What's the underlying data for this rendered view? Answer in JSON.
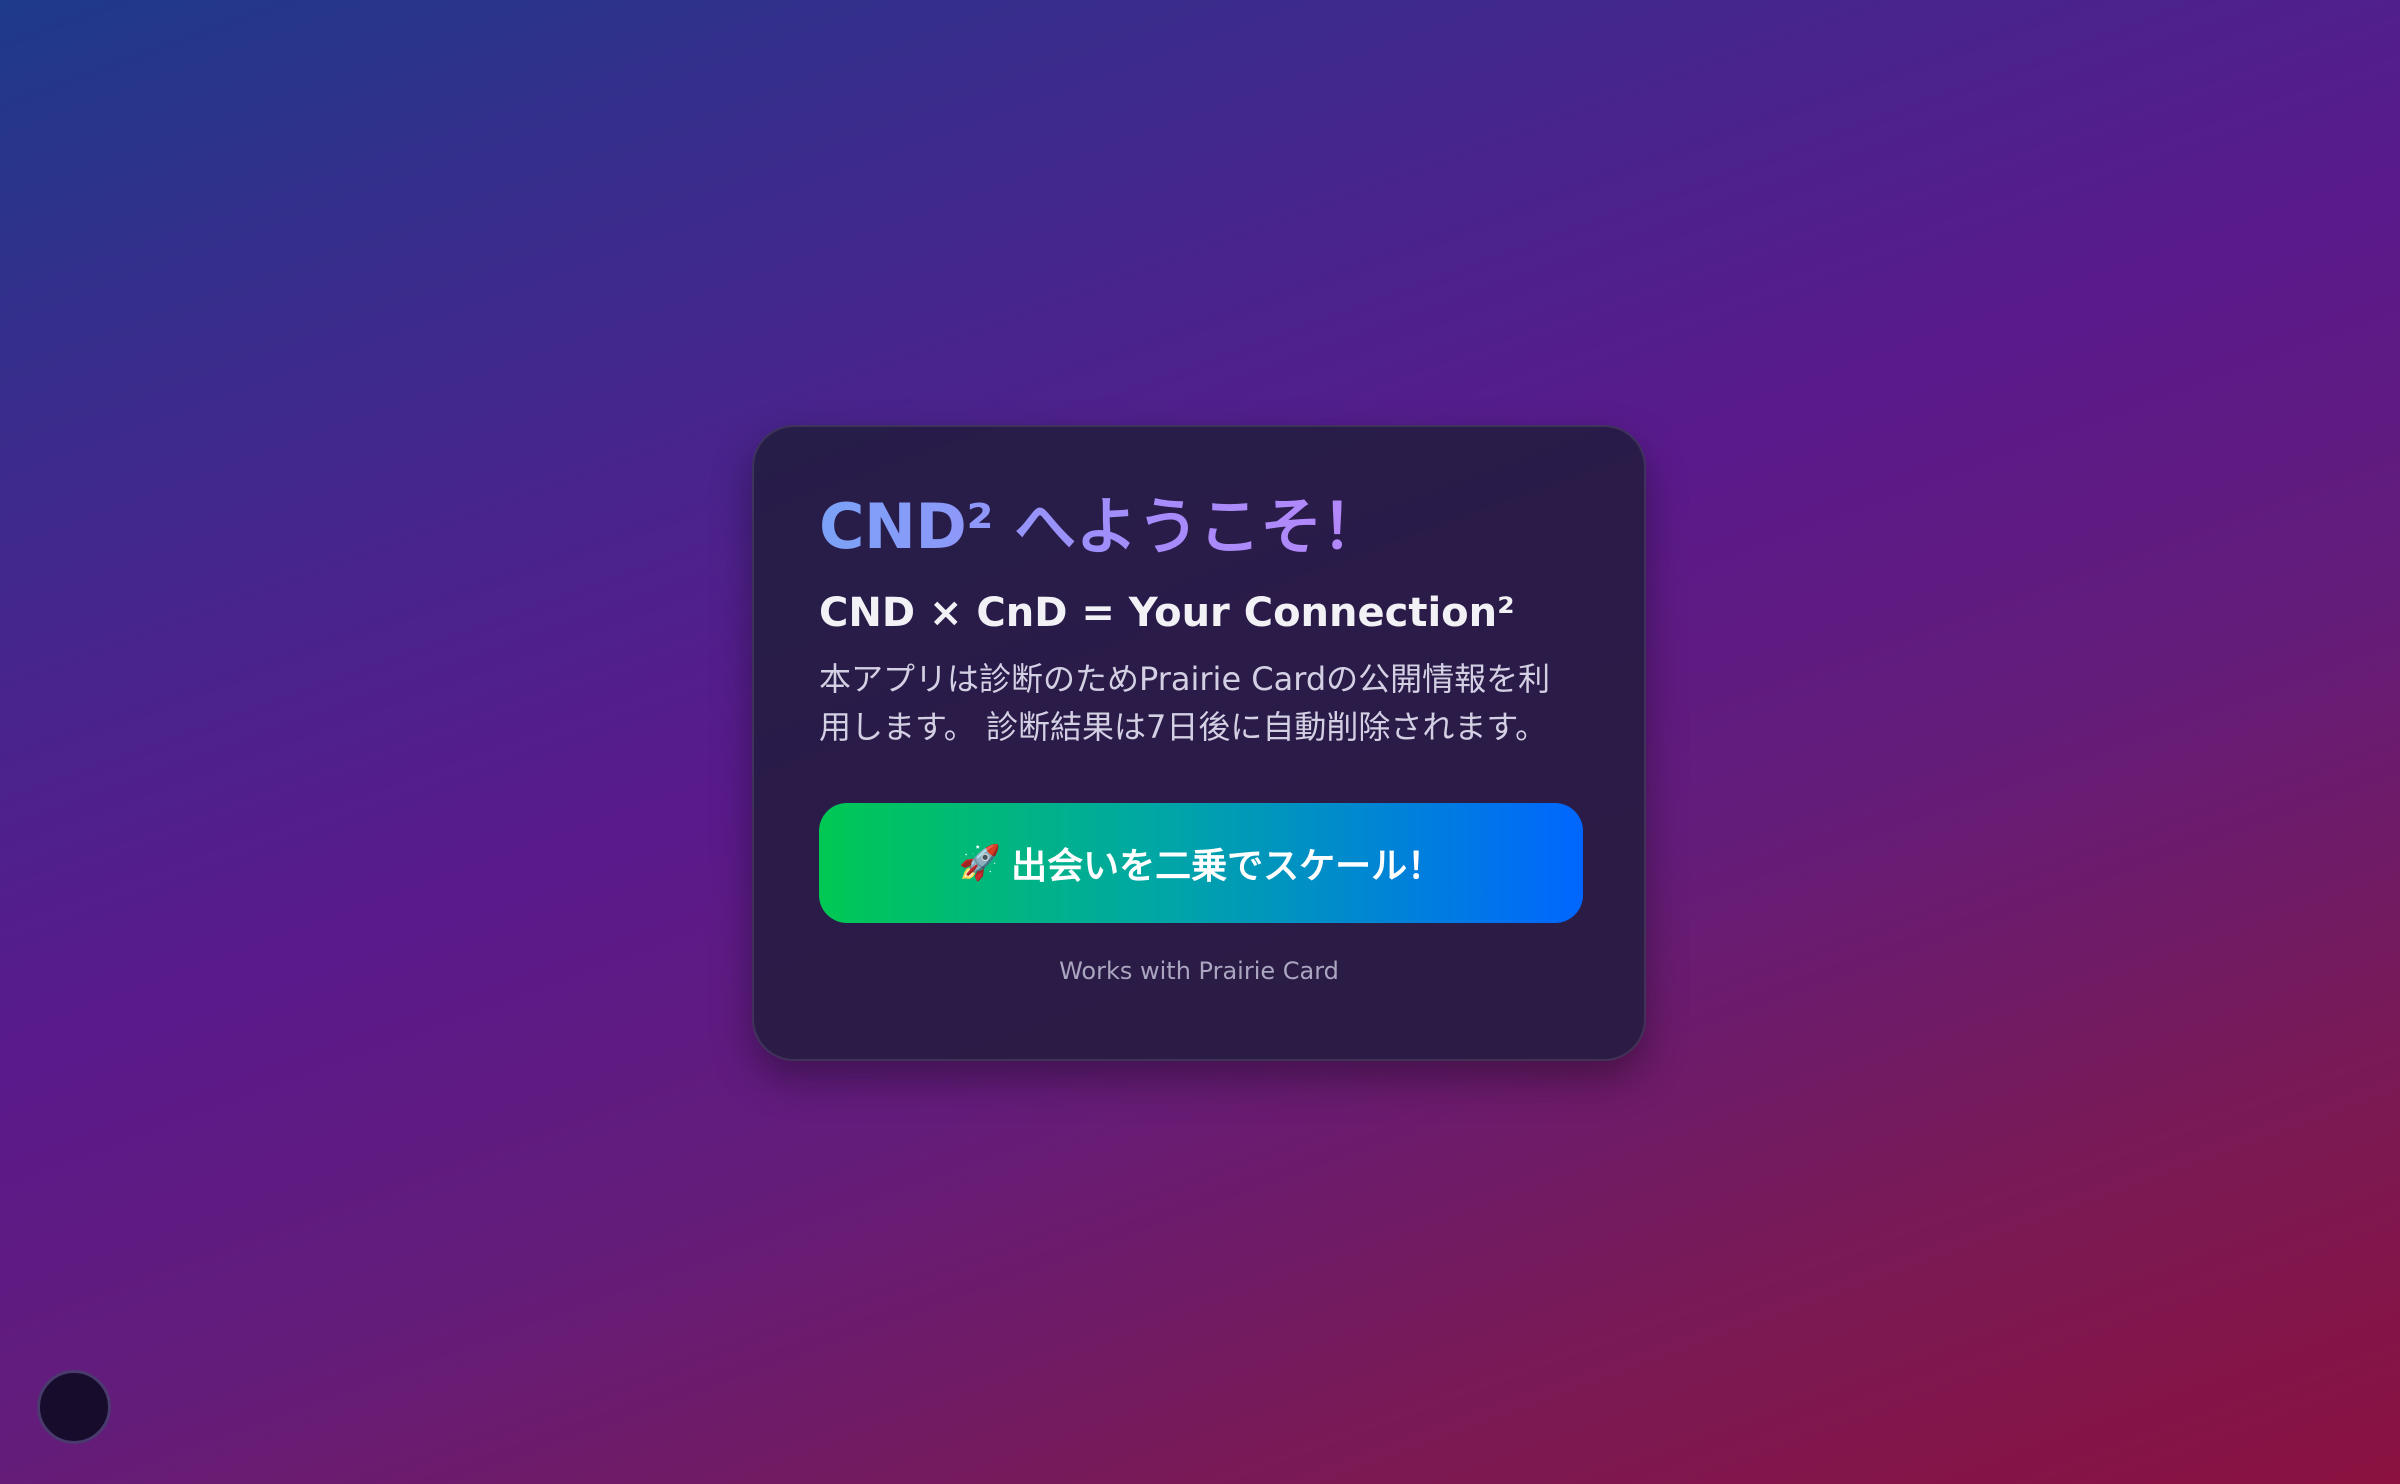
{
  "card": {
    "title": "CND² へようこそ！",
    "subtitle": "CND × CnD = Your Connection²",
    "description": "本アプリは診断のためPrairie Cardの公開情報を利用します。 診断結果は7日後に自動削除されます。",
    "cta_icon": "🚀",
    "cta_label": "出会いを二乗でスケール！",
    "footnote": "Works with Prairie Card"
  },
  "floating_button": {
    "icon": "circle"
  },
  "colors": {
    "title_gradient_start": "#7aa2f7",
    "title_gradient_end": "#c084fc",
    "cta_gradient_start": "#00c853",
    "cta_gradient_end": "#0066ff",
    "card_background": "#221c3e"
  }
}
